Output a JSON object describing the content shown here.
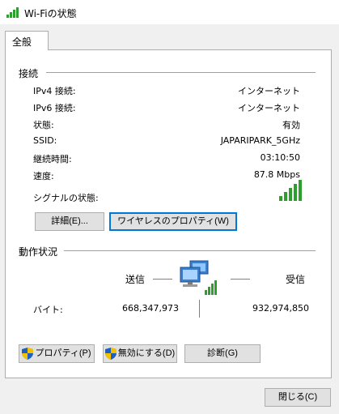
{
  "window": {
    "title": "Wi-Fiの状態"
  },
  "tabs": [
    {
      "label": "全般"
    }
  ],
  "connection": {
    "section_title": "接続",
    "rows": [
      {
        "label": "IPv4 接続:",
        "value": "インターネット"
      },
      {
        "label": "IPv6 接続:",
        "value": "インターネット"
      },
      {
        "label": "状態:",
        "value": "有効"
      },
      {
        "label": "SSID:",
        "value": "JAPARIPARK_5GHz"
      },
      {
        "label": "継続時間:",
        "value": "03:10:50"
      },
      {
        "label": "速度:",
        "value": "87.8 Mbps"
      }
    ],
    "signal_label": "シグナルの状態:",
    "signal_bars": 5,
    "signal_max": 5,
    "details_button": "詳細(E)...",
    "wireless_properties_button": "ワイヤレスのプロパティ(W)"
  },
  "activity": {
    "section_title": "動作状況",
    "sent_label": "送信",
    "received_label": "受信",
    "bytes_label": "バイト:",
    "bytes_sent": "668,347,973",
    "bytes_received": "932,974,850"
  },
  "actions": {
    "properties_button": "プロパティ(P)",
    "disable_button": "無効にする(D)",
    "diagnose_button": "診断(G)"
  },
  "footer": {
    "close_button": "閉じる(C)"
  },
  "colors": {
    "accent": "#0078d7",
    "signal_green": "#2e9e2e",
    "shield_blue": "#1f5fbf",
    "shield_yellow": "#f2c200"
  }
}
